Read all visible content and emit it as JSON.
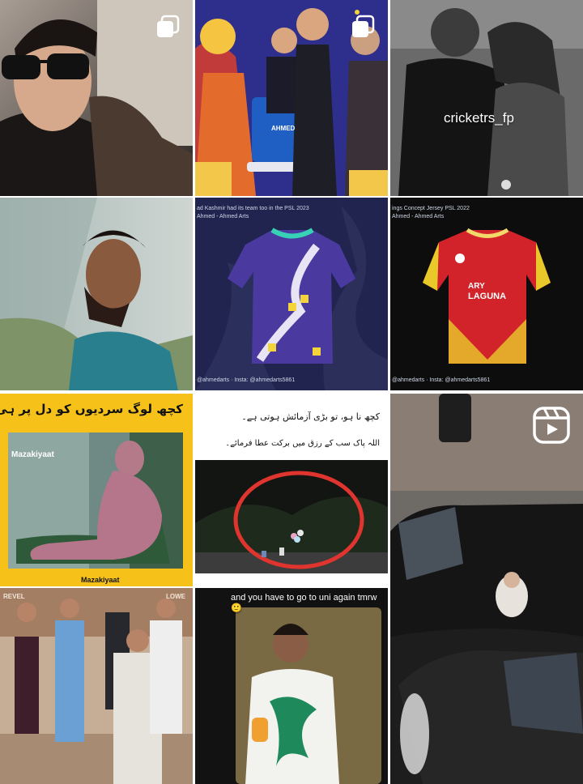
{
  "profile_grid": {
    "posts": [
      {
        "kind": "multi-image"
      },
      {
        "kind": "multi-image",
        "cake_name": "AHMED"
      },
      {
        "kind": "image",
        "caption": "cricketrs_fp"
      },
      {
        "kind": "image"
      },
      {
        "kind": "image",
        "header": "ad Kashmir had its team too in the PSL 2023",
        "credit": "Ahmed - Ahmed Arts",
        "footer": "@ahmedarts · Insta: @ahmedarts5861"
      },
      {
        "kind": "image",
        "header": "ings Concept Jersey PSL 2022",
        "credit": "Ahmed - Ahmed Arts",
        "jersey_brand": "ARY",
        "jersey_sponsor": "LAGUNA",
        "footer": "@ahmedarts · Insta: @ahmedarts5861"
      },
      {
        "kind": "image",
        "urdu_title": "کچھ لوگ سردیوں کو دل پر ہی لیتے ہیں",
        "watermark": "Mazakiyaat",
        "footer": "Mazakiyaat"
      },
      {
        "kind": "image",
        "urdu_line1": "کچھ نا ہو، تو بڑی آزمائش ہوتی ہے۔",
        "urdu_line2": "اللہ پاک سب کے رزق میں برکت عطا فرمائے۔"
      },
      {
        "kind": "reel"
      },
      {
        "kind": "image",
        "sign_left": "REVEL",
        "sign_right": "LOWE"
      },
      {
        "kind": "image",
        "caption": "and you have to go to uni again tmrw 🙂"
      }
    ]
  },
  "colors": {
    "urdu_frame": "#f6c21a",
    "red_circle": "#e0342e"
  }
}
